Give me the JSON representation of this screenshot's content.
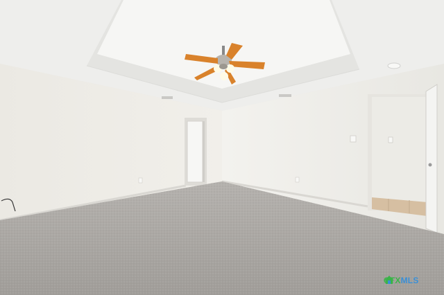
{
  "scene": {
    "description_name": "empty-bedroom-tray-ceiling",
    "colors": {
      "ceiling": "#f1f1ef",
      "tray": "#f5f5f3",
      "wall_left": "#efeee9",
      "wall_right": "#f2f1ed",
      "carpet": "#a9a6a2",
      "fan_blade": "#d9822b",
      "door": "#f6f6f4",
      "tile": "#d8c3a7"
    }
  },
  "watermark": {
    "brand_left": "CTX",
    "brand_right": "MLS"
  }
}
